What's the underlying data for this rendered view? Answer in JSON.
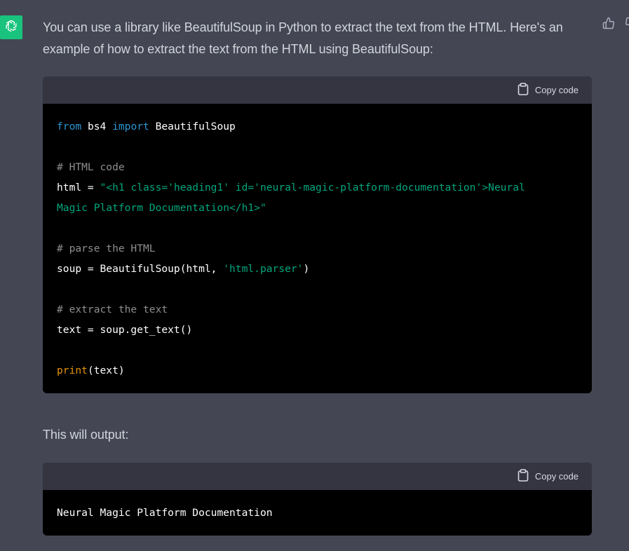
{
  "assistant": {
    "avatar_icon": "openai-logo-icon",
    "avatar_color": "#19c37d"
  },
  "feedback": {
    "thumbs_up_icon": "thumbs-up-icon",
    "thumbs_down_icon": "thumbs-down-icon"
  },
  "message": {
    "intro": "You can use a library like BeautifulSoup in Python to extract the text from the HTML. Here's an example of how to extract the text from the HTML using BeautifulSoup:",
    "outro": "This will output:"
  },
  "code_block_1": {
    "copy_label": "Copy code",
    "lines": [
      [
        {
          "t": "from",
          "c": "kw"
        },
        {
          "t": " bs4 ",
          "c": "plain"
        },
        {
          "t": "import",
          "c": "kw"
        },
        {
          "t": " BeautifulSoup",
          "c": "plain"
        }
      ],
      [],
      [
        {
          "t": "# HTML code",
          "c": "com"
        }
      ],
      [
        {
          "t": "html = ",
          "c": "plain"
        },
        {
          "t": "\"<h1 class='heading1' id='neural-magic-platform-documentation'>Neural",
          "c": "str"
        }
      ],
      [
        {
          "t": "Magic Platform Documentation</h1>\"",
          "c": "str"
        }
      ],
      [],
      [
        {
          "t": "# parse the HTML",
          "c": "com"
        }
      ],
      [
        {
          "t": "soup = BeautifulSoup(html, ",
          "c": "plain"
        },
        {
          "t": "'html.parser'",
          "c": "str"
        },
        {
          "t": ")",
          "c": "plain"
        }
      ],
      [],
      [
        {
          "t": "# extract the text",
          "c": "com"
        }
      ],
      [
        {
          "t": "text = soup.get_text()",
          "c": "plain"
        }
      ],
      [],
      [
        {
          "t": "print",
          "c": "bi"
        },
        {
          "t": "(text)",
          "c": "plain"
        }
      ]
    ]
  },
  "code_block_2": {
    "copy_label": "Copy code",
    "lines": [
      [
        {
          "t": "Neural Magic Platform Documentation",
          "c": "plain"
        }
      ]
    ]
  },
  "colors": {
    "background": "#444654",
    "code_header": "#343541",
    "code_bg": "#000000",
    "keyword": "#2e95d3",
    "string": "#00a67d",
    "comment": "#8e8e8e",
    "builtin": "#e9950c"
  }
}
